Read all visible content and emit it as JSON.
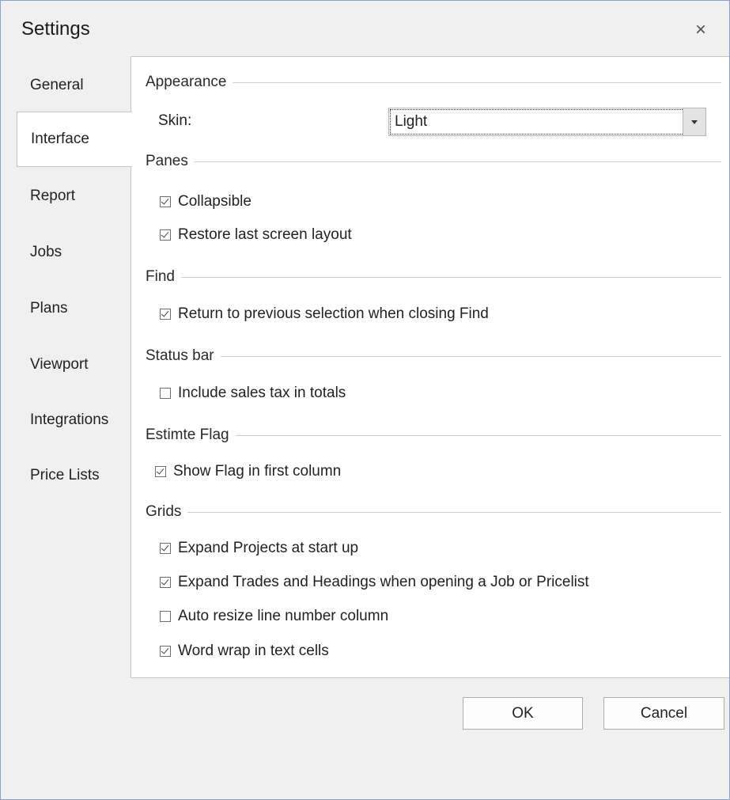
{
  "window": {
    "title": "Settings",
    "close_glyph": "×"
  },
  "sidebar": {
    "items": [
      {
        "label": "General"
      },
      {
        "label": "Interface",
        "selected": true
      },
      {
        "label": "Report"
      },
      {
        "label": "Jobs"
      },
      {
        "label": "Plans"
      },
      {
        "label": "Viewport"
      },
      {
        "label": "Integrations"
      },
      {
        "label": "Price Lists"
      }
    ]
  },
  "appearance": {
    "heading": "Appearance",
    "skin_label": "Skin:",
    "skin_value": "Light"
  },
  "panes": {
    "heading": "Panes",
    "collapsible": {
      "label": "Collapsible",
      "checked": true
    },
    "restore_layout": {
      "label": "Restore last screen layout",
      "checked": true
    }
  },
  "find": {
    "heading": "Find",
    "return_selection": {
      "label": "Return to previous selection when closing Find",
      "checked": true
    }
  },
  "status_bar": {
    "heading": "Status bar",
    "sales_tax": {
      "label": "Include sales tax in totals",
      "checked": false
    }
  },
  "estimate_flag": {
    "heading": "Estimte Flag",
    "show_flag": {
      "label": "Show Flag in first column",
      "checked": true
    }
  },
  "grids": {
    "heading": "Grids",
    "expand_projects": {
      "label": "Expand Projects at start up",
      "checked": true
    },
    "expand_trades": {
      "label": "Expand Trades and Headings when opening a Job or Pricelist",
      "checked": true
    },
    "auto_resize": {
      "label": "Auto resize line number column",
      "checked": false
    },
    "word_wrap": {
      "label": "Word wrap in text cells",
      "checked": true
    }
  },
  "footer": {
    "ok_label": "OK",
    "cancel_label": "Cancel"
  },
  "colors": {
    "dialog_bg": "#f0f0f0",
    "content_bg": "#ffffff",
    "border": "#c7c7c7",
    "window_border": "#8aa4c8"
  }
}
